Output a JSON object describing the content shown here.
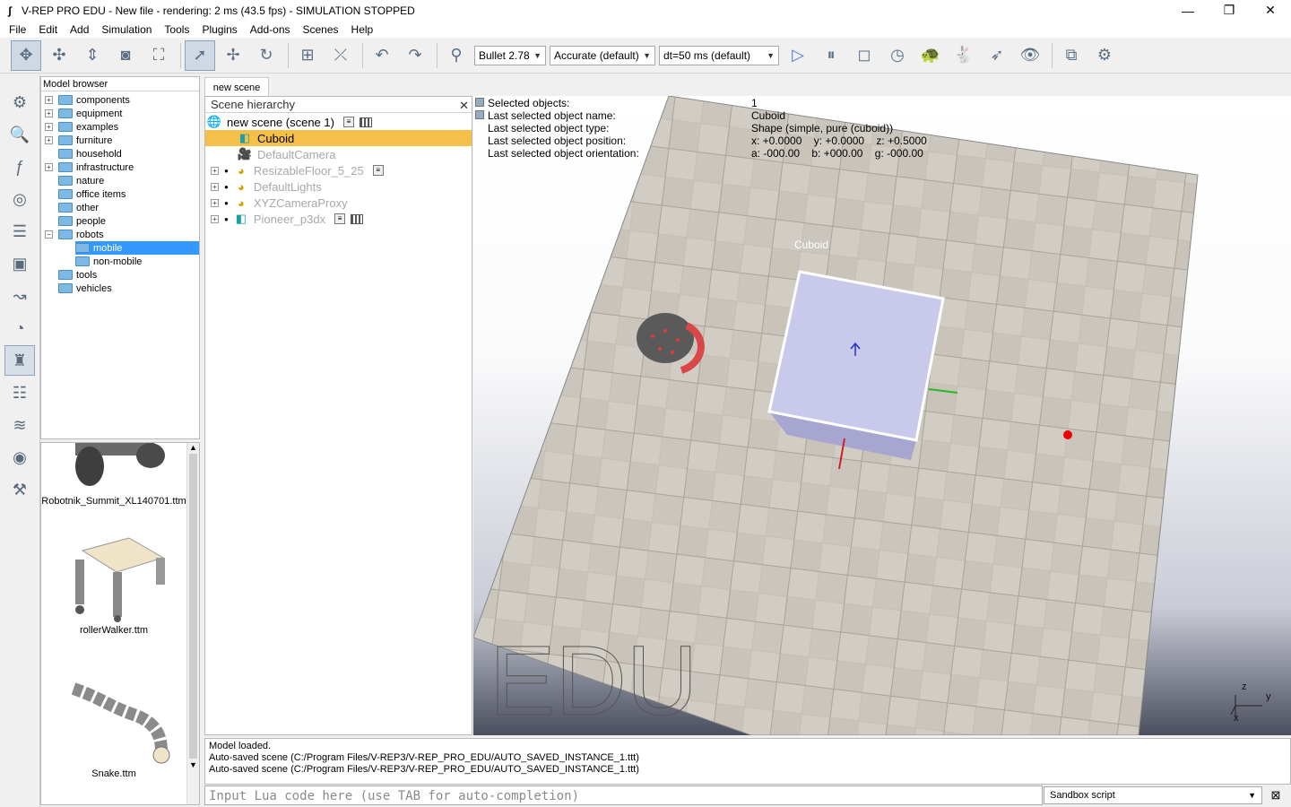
{
  "window": {
    "title": "V-REP PRO EDU - New file - rendering: 2 ms (43.5 fps) - SIMULATION STOPPED"
  },
  "menu": [
    "File",
    "Edit",
    "Add",
    "Simulation",
    "Tools",
    "Plugins",
    "Add-ons",
    "Scenes",
    "Help"
  ],
  "toolbar": {
    "engine": "Bullet 2.78",
    "accuracy": "Accurate (default)",
    "timestep": "dt=50 ms (default)"
  },
  "model_browser": {
    "title": "Model browser",
    "items": [
      {
        "label": "components"
      },
      {
        "label": "equipment"
      },
      {
        "label": "examples"
      },
      {
        "label": "furniture"
      },
      {
        "label": "household"
      },
      {
        "label": "infrastructure"
      },
      {
        "label": "nature"
      },
      {
        "label": "office items"
      },
      {
        "label": "other"
      },
      {
        "label": "people"
      },
      {
        "label": "robots"
      },
      {
        "label": "mobile"
      },
      {
        "label": "non-mobile"
      },
      {
        "label": "tools"
      },
      {
        "label": "vehicles"
      }
    ],
    "thumbnails": [
      "Robotnik_Summit_XL140701.ttm",
      "rollerWalker.ttm",
      "Snake.ttm"
    ]
  },
  "scene_tab": "new scene",
  "hierarchy": {
    "title": "Scene hierarchy",
    "root": "new scene (scene 1)",
    "items": [
      {
        "label": "Cuboid"
      },
      {
        "label": "DefaultCamera"
      },
      {
        "label": "ResizableFloor_5_25"
      },
      {
        "label": "DefaultLights"
      },
      {
        "label": "XYZCameraProxy"
      },
      {
        "label": "Pioneer_p3dx"
      }
    ]
  },
  "info": {
    "rows": [
      {
        "k": "Selected objects:",
        "v": "1"
      },
      {
        "k": "Last selected object name:",
        "v": "Cuboid"
      },
      {
        "k": "Last selected object type:",
        "v": "Shape (simple, pure (cuboid))"
      },
      {
        "k": "Last selected object position:",
        "v": "x: +0.0000    y: +0.0000    z: +0.5000"
      },
      {
        "k": "Last selected object orientation:",
        "v": "a: -000.00    b: +000.00    g: -000.00"
      }
    ]
  },
  "viewport": {
    "object_label": "Cuboid",
    "watermark": "EDU",
    "axes": {
      "x": "x",
      "y": "y",
      "z": "z"
    }
  },
  "console": {
    "lines": [
      "Model loaded.",
      "Auto-saved scene (C:/Program Files/V-REP3/V-REP_PRO_EDU/AUTO_SAVED_INSTANCE_1.ttt)",
      "Auto-saved scene (C:/Program Files/V-REP3/V-REP_PRO_EDU/AUTO_SAVED_INSTANCE_1.ttt)"
    ],
    "input_placeholder": "Input Lua code here (use TAB for auto-completion)",
    "script_select": "Sandbox script"
  }
}
